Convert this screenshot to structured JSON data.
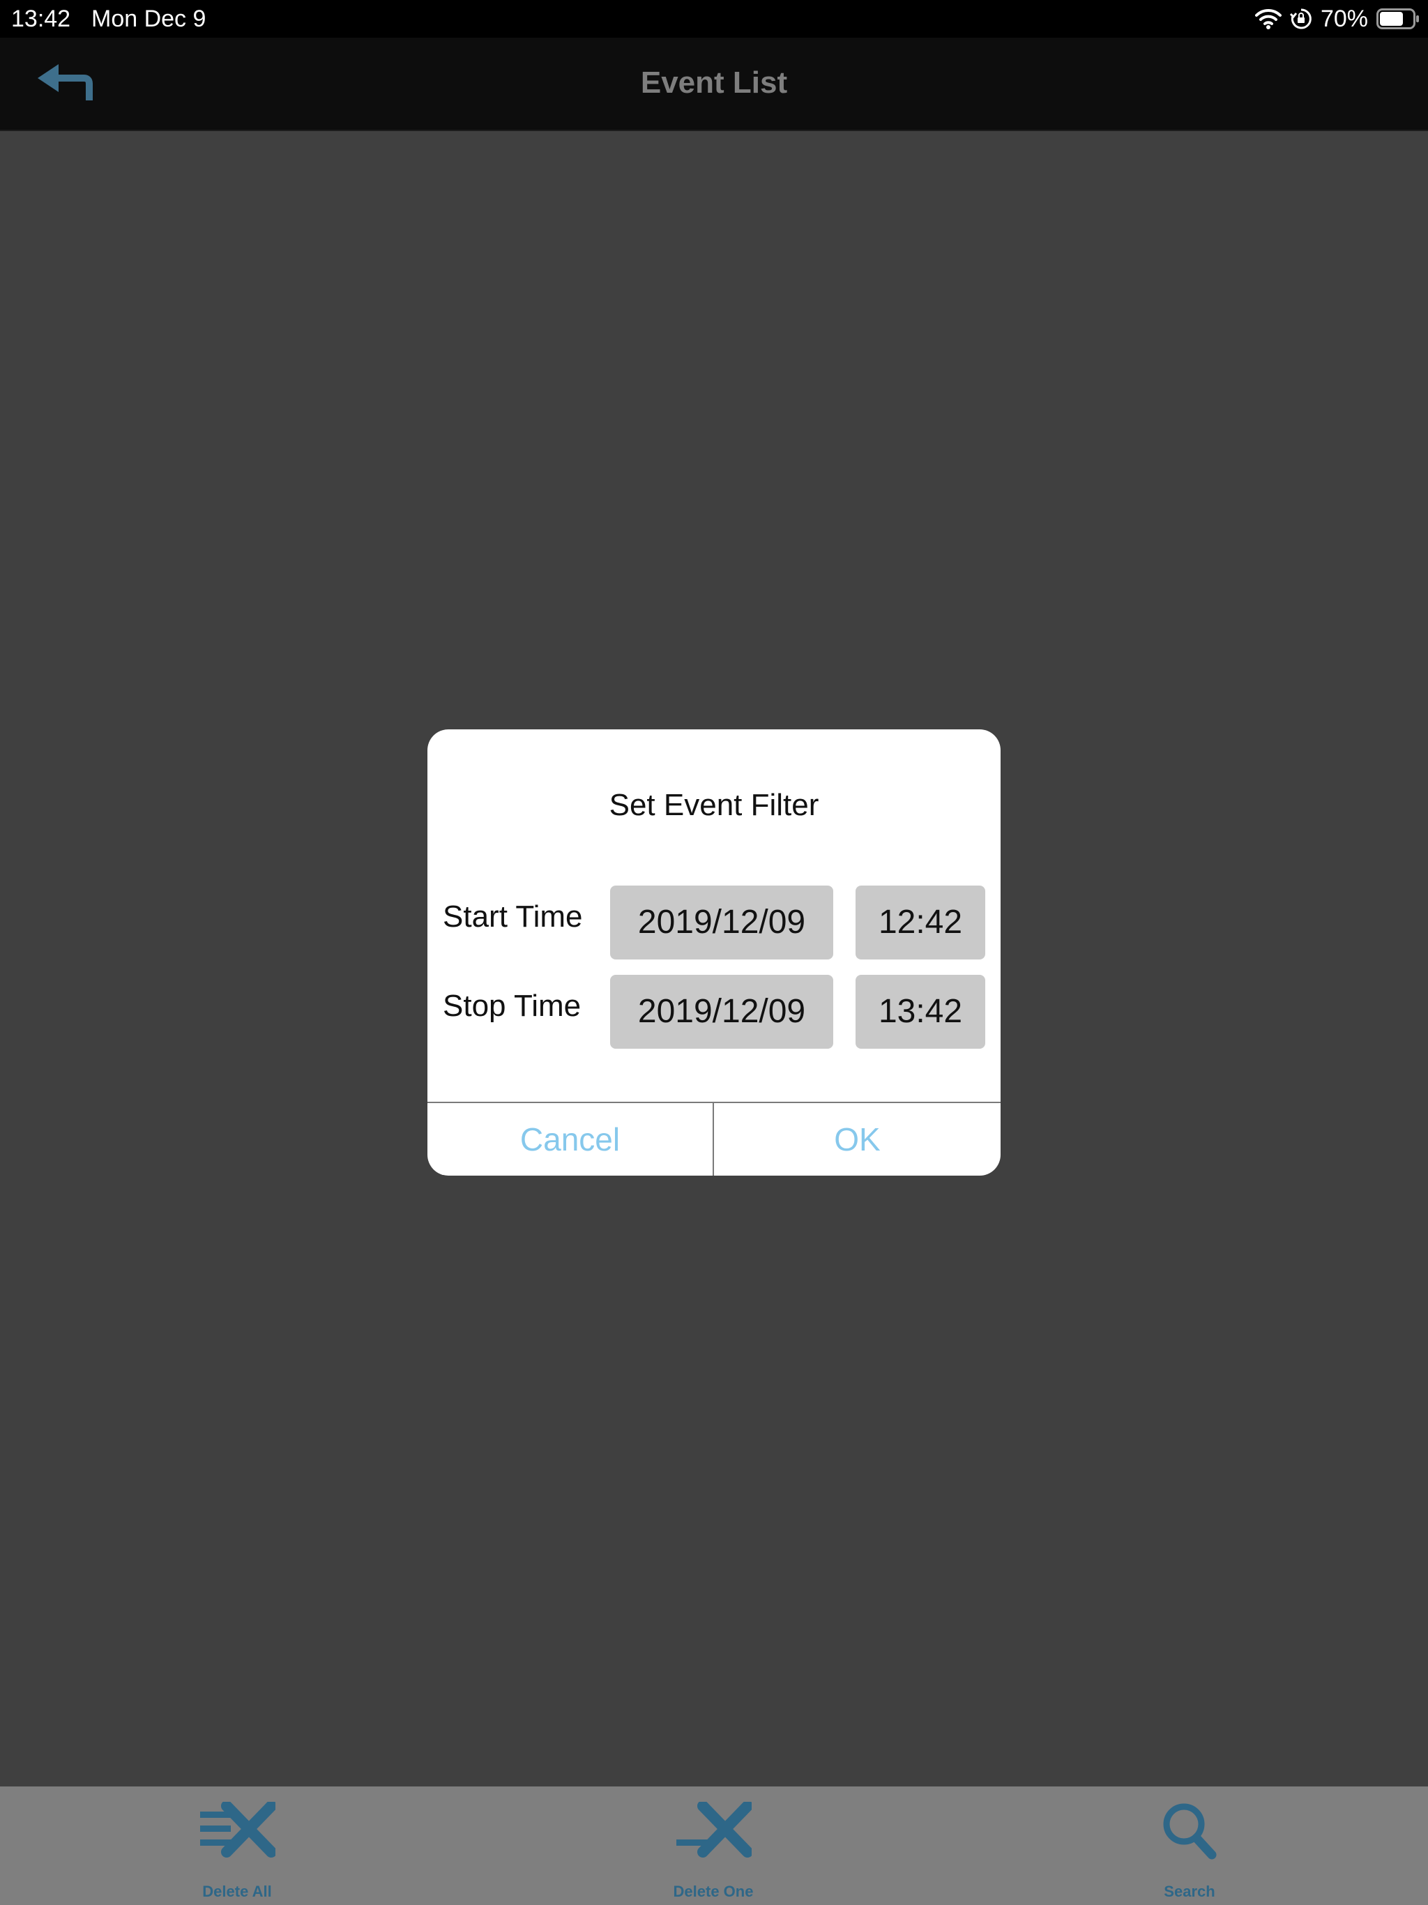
{
  "status_bar": {
    "time": "13:42",
    "date": "Mon Dec 9",
    "battery_percent": "70%",
    "battery_level": 0.7,
    "icons": [
      "wifi-icon",
      "orientation-lock-icon",
      "battery-icon"
    ]
  },
  "nav": {
    "title": "Event List",
    "back_icon": "back-arrow-icon"
  },
  "dialog": {
    "title": "Set Event Filter",
    "start": {
      "label": "Start Time",
      "date": "2019/12/09",
      "time": "12:42"
    },
    "stop": {
      "label": "Stop Time",
      "date": "2019/12/09",
      "time": "13:42"
    },
    "cancel_label": "Cancel",
    "ok_label": "OK"
  },
  "toolbar": {
    "items": [
      {
        "label": "Delete All",
        "icon": "delete-all-icon"
      },
      {
        "label": "Delete One",
        "icon": "delete-one-icon"
      },
      {
        "label": "Search",
        "icon": "search-icon"
      }
    ]
  },
  "colors": {
    "accent": "#2e6788",
    "dialog_button": "#86c8ec",
    "backdrop": "#404040",
    "toolbar": "#7f7f7f",
    "picker_bg": "#c9c9c9"
  }
}
